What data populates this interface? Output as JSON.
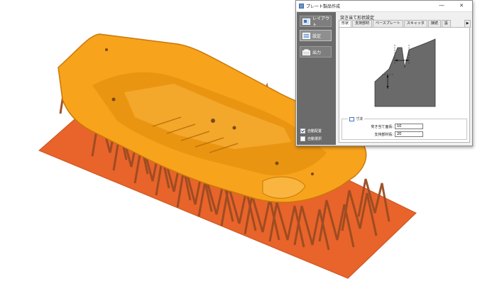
{
  "dialog": {
    "title": "プレート製品作成",
    "minimize_glyph": "—",
    "close_glyph": "✕"
  },
  "nav": {
    "items": [
      {
        "label": "レイアウト",
        "icon": "layout-icon"
      },
      {
        "label": "設定",
        "icon": "settings-icon"
      },
      {
        "label": "出力",
        "icon": "output-icon"
      }
    ],
    "checkboxes": [
      {
        "label": "自動配置",
        "checked": true
      },
      {
        "label": "自動選択",
        "checked": false
      }
    ]
  },
  "section": {
    "title": "突き当て形状設定",
    "tabs": [
      "形状",
      "支持部材",
      "ベースプレート",
      "スキャッタ",
      "接続",
      "設"
    ],
    "active_tab": 0,
    "tab_arrow": "▶"
  },
  "params": {
    "group_label": "寸法",
    "fields": [
      {
        "label": "突き当て面長:",
        "value": "10"
      },
      {
        "label": "支持部材長:",
        "value": "20"
      }
    ]
  },
  "colors": {
    "background_plate": "#e8642a",
    "part": "#f7a31c",
    "part_shadow": "#c97808",
    "supports": "#9b4b22",
    "nav_bg": "#6b6b6b"
  }
}
